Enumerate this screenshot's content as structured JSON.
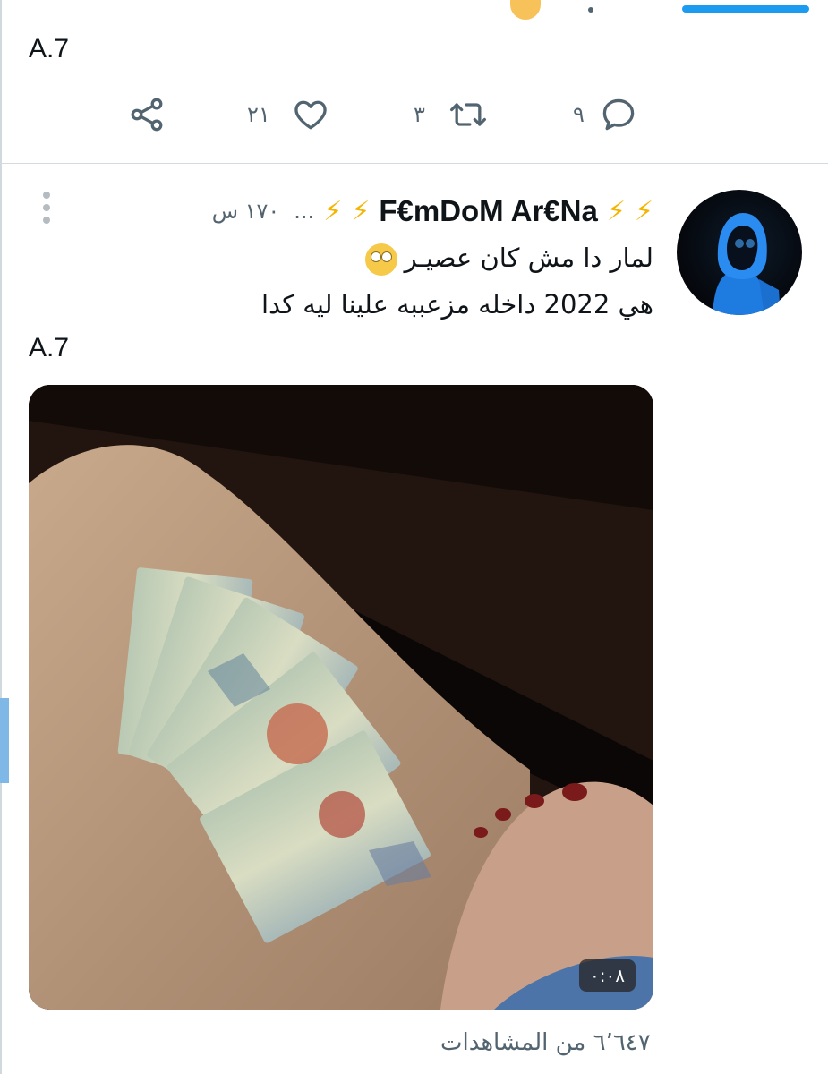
{
  "previous_tweet": {
    "label": "A.7",
    "actions": {
      "replies": "٩",
      "retweets": "٣",
      "likes": "٢١"
    }
  },
  "tweet": {
    "display_name": "F€mDoM Ar€Na",
    "name_truncation": "...",
    "timestamp": "١٧٠ س",
    "text_line_1": "لمار دا مش كان عصيـر",
    "text_line_2": "هي 2022 داخله مزعببه علينا ليه كدا",
    "label": "A.7",
    "media": {
      "duration": "٠:٠٨"
    },
    "views": "٦٬٦٤٧ من المشاهدات"
  },
  "icons": [
    "share-icon",
    "like-icon",
    "retweet-icon",
    "reply-icon",
    "more-icon",
    "lightning-icon",
    "eye-roll-emoji"
  ],
  "colors": {
    "accent": "#1d9bf0",
    "secondary_text": "#536471",
    "bolt": "#f5b400"
  }
}
